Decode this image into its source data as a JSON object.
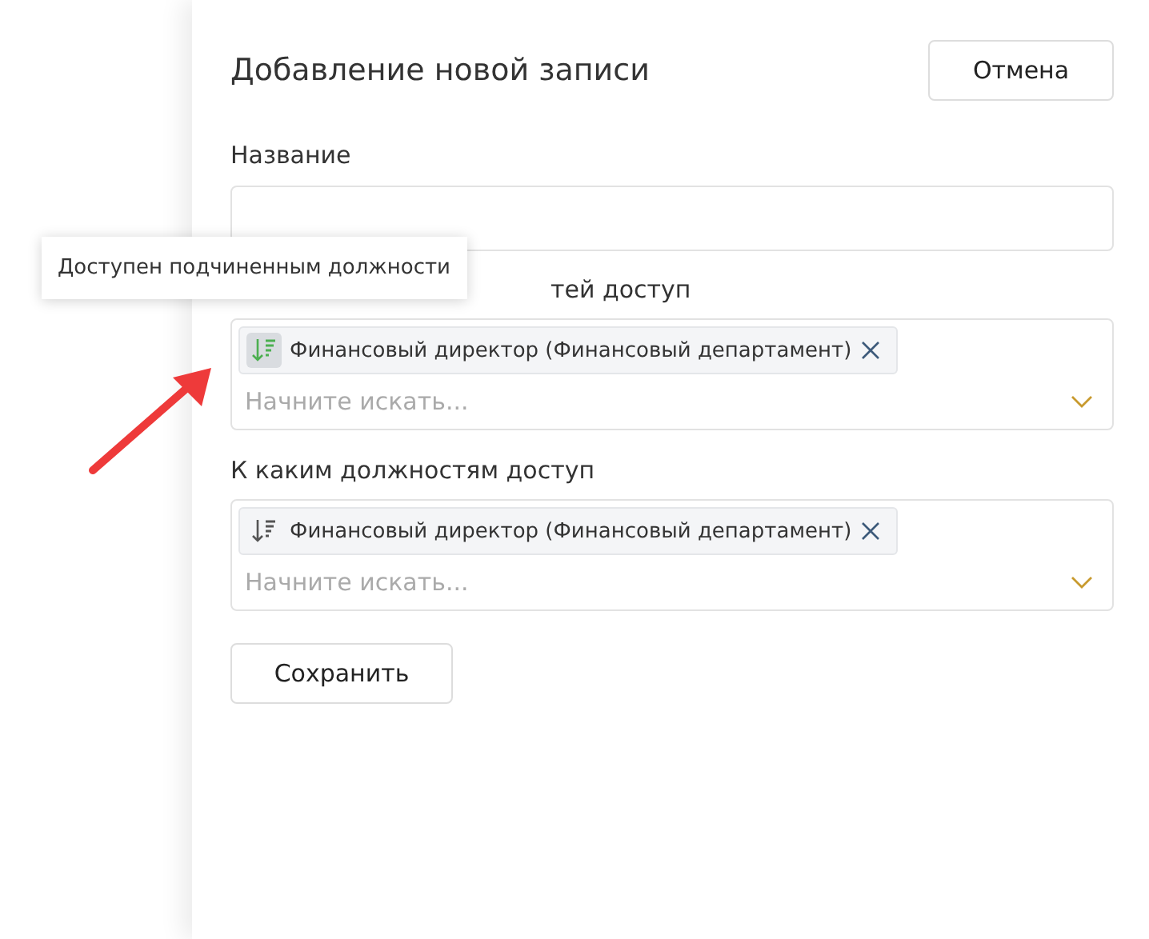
{
  "panel": {
    "title": "Добавление новой записи",
    "cancel_button": "Отмена"
  },
  "name_field": {
    "label": "Название"
  },
  "selects": [
    {
      "label": "тей доступ",
      "chips": [
        {
          "text": "Финансовый директор (Финансовый департамент)",
          "icon_highlighted": true
        }
      ],
      "placeholder": "Начните искать..."
    },
    {
      "label": "К каким должностям доступ",
      "chips": [
        {
          "text": "Финансовый директор (Финансовый департамент)",
          "icon_highlighted": false
        }
      ],
      "placeholder": "Начните искать..."
    }
  ],
  "save_button": "Сохранить",
  "tooltip": {
    "text": "Доступен подчиненным должности"
  },
  "annotation": {
    "kind": "arrow"
  }
}
